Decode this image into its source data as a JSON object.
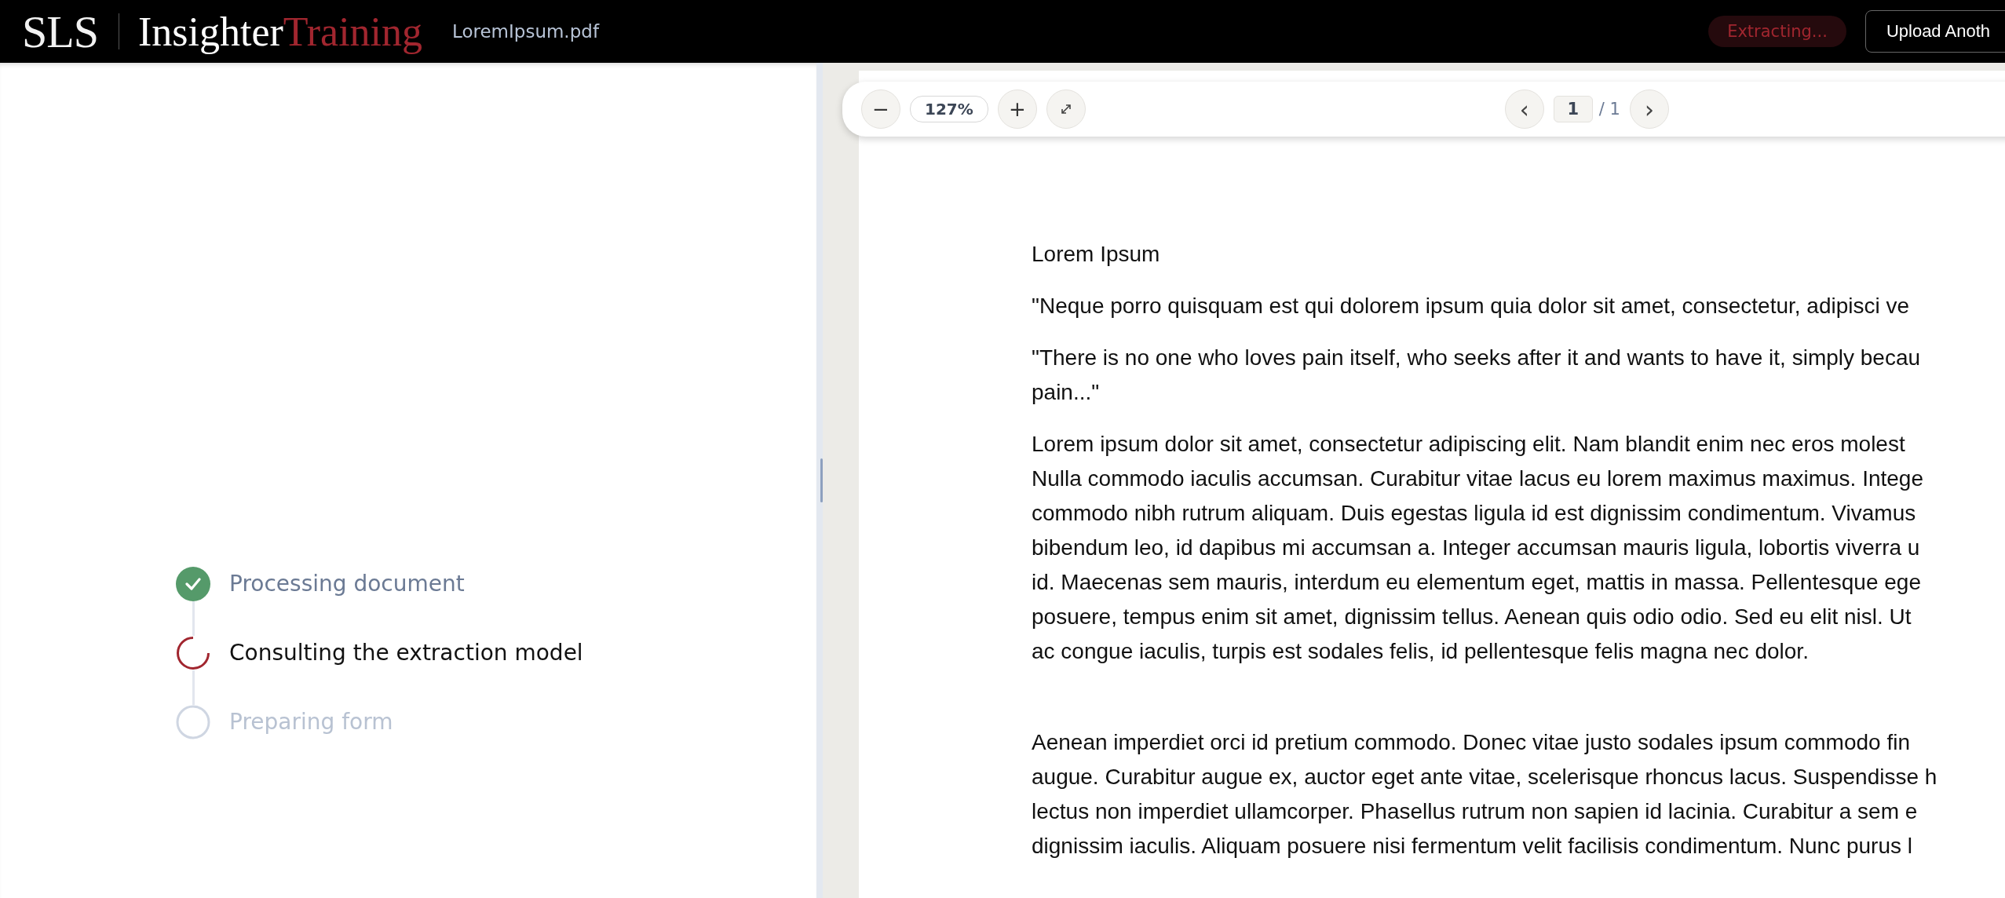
{
  "header": {
    "logo_mark": "SLS",
    "logo_word": "Insighter",
    "logo_accent": "Training",
    "file_name": "LoremIpsum.pdf",
    "status_badge": "Extracting...",
    "upload_button": "Upload Anoth"
  },
  "steps": [
    {
      "label": "Processing document",
      "kind": "done"
    },
    {
      "label": "Consulting the extraction model",
      "kind": "active"
    },
    {
      "label": "Preparing form",
      "kind": "pending"
    }
  ],
  "toolbar": {
    "zoom_out": "−",
    "zoom": "127%",
    "zoom_in": "+",
    "prev": "‹",
    "page": "1",
    "page_total": "/ 1",
    "next": "›"
  },
  "document": {
    "paragraphs": [
      [
        "Lorem Ipsum"
      ],
      [
        "\"Neque porro quisquam est qui dolorem ipsum quia dolor sit amet, consectetur, adipisci ve"
      ],
      [
        "\"There is no one who loves pain itself, who seeks after it and wants to have it, simply becau",
        "pain...\""
      ],
      [
        "Lorem ipsum dolor sit amet, consectetur adipiscing elit. Nam blandit enim nec eros molest",
        "Nulla commodo iaculis accumsan. Curabitur vitae lacus eu lorem maximus maximus. Intege",
        "commodo nibh rutrum aliquam. Duis egestas ligula id est dignissim condimentum. Vivamus",
        "bibendum leo, id dapibus mi accumsan a. Integer accumsan mauris ligula, lobortis viverra u",
        "id. Maecenas sem mauris, interdum eu elementum eget, mattis in massa. Pellentesque ege",
        "posuere, tempus enim sit amet, dignissim tellus. Aenean quis odio odio. Sed eu elit nisl. Ut",
        "ac congue iaculis, turpis est sodales felis, id pellentesque felis magna nec dolor."
      ],
      [
        "Aenean imperdiet orci id pretium commodo. Donec vitae justo sodales ipsum commodo fin",
        "augue. Curabitur augue ex, auctor eget ante vitae, scelerisque rhoncus lacus. Suspendisse h",
        "lectus non imperdiet ullamcorper. Phasellus rutrum non sapien id lacinia. Curabitur a sem e",
        "dignissim iaculis. Aliquam posuere nisi fermentum velit facilisis condimentum. Nunc purus l"
      ]
    ]
  }
}
